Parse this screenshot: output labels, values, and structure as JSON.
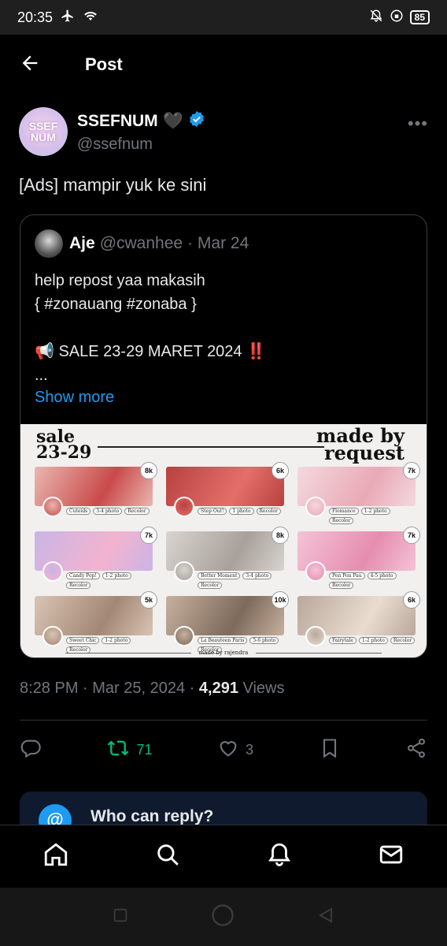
{
  "status_bar": {
    "time": "20:35",
    "battery": "85"
  },
  "header": {
    "title": "Post"
  },
  "author": {
    "name": "SSEFNUM",
    "heart": "🖤",
    "handle": "@ssefnum",
    "avatar_text": "SSEF NUM"
  },
  "post": {
    "text": "[Ads] mampir yuk ke sini"
  },
  "quote": {
    "name": "Aje",
    "handle": "@cwanhee",
    "date": "· Mar 24",
    "body": "help repost yaa makasih\n{ #zonauang #zonaba }\n\n📢 SALE 23-29 MARET 2024 ‼️\n...",
    "show_more": "Show more"
  },
  "promo": {
    "sale_line1": "sale",
    "sale_line2": "23-29",
    "made_by_line1": "made by",
    "made_by_line2": "request",
    "footer": "made by rajendra",
    "cards": [
      {
        "badge": "8k",
        "name": "Cuteids",
        "photos": "3-4 photo",
        "extra": "Recolor",
        "color1": "#e9b7b0",
        "color2": "#c94a4a"
      },
      {
        "badge": "6k",
        "name": "Step Out!",
        "photos": "1 photo",
        "extra": "Recolor",
        "color1": "#b8413f",
        "color2": "#e36f6b"
      },
      {
        "badge": "7k",
        "name": "Flomance",
        "photos": "1-2 photo",
        "extra": "Recolor",
        "color1": "#f4d9df",
        "color2": "#e9a9b6"
      },
      {
        "badge": "7k",
        "name": "Candy Pop!",
        "photos": "1-2 photo",
        "extra": "Recolor",
        "color1": "#c9b5e6",
        "color2": "#f3b3cf"
      },
      {
        "badge": "8k",
        "name": "Better Moment",
        "photos": "3-4 photo",
        "extra": "Recolor",
        "color1": "#d9d4d0",
        "color2": "#a8a19b"
      },
      {
        "badge": "7k",
        "name": "Pon Pon Pau",
        "photos": "4-5 photo",
        "extra": "Recolor",
        "color1": "#f5c3d6",
        "color2": "#e58db0"
      },
      {
        "badge": "5k",
        "name": "Sweet Chic",
        "photos": "1-2 photo",
        "extra": "Recolor",
        "color1": "#d9c4b4",
        "color2": "#a38775"
      },
      {
        "badge": "10k",
        "name": "La Beauteen Paris",
        "photos": "5-6 photo",
        "extra": "Recolor",
        "color1": "#c7b09f",
        "color2": "#7d6a5b"
      },
      {
        "badge": "6k",
        "name": "Fairytale",
        "photos": "1-2 photo",
        "extra": "Recolor",
        "color1": "#b9a79a",
        "color2": "#e9ddd0"
      }
    ]
  },
  "meta": {
    "time": "8:28 PM · Mar 25, 2024 · ",
    "views_count": "4,291",
    "views_label": " Views"
  },
  "actions": {
    "retweets": "71",
    "likes": "3"
  },
  "reply_card": {
    "title": "Who can reply?",
    "icon": "@"
  },
  "colors": {
    "accent": "#1d9bf0",
    "retweet": "#00ba7c",
    "muted": "#71767b"
  }
}
